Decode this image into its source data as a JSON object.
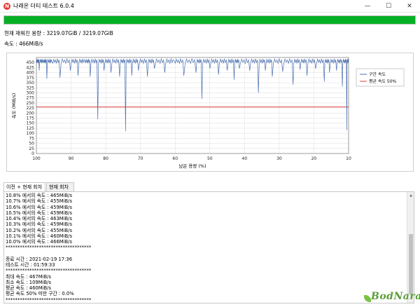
{
  "window": {
    "title": "나래온 더티 테스트 6.0.4",
    "app_icon_glyph": "N",
    "min_glyph": "—",
    "max_glyph": "☐",
    "close_glyph": "✕"
  },
  "progress": {
    "fraction": 1.0,
    "color": "#06b025"
  },
  "info": {
    "remaining": "현재 재워진 용량 : 3219.07GiB / 3219.07GiB",
    "speed": "속도 : 466MiB/s"
  },
  "chart_data": {
    "type": "line",
    "xlabel": "남은 용량 (%)",
    "ylabel": "속도 (MiB/s)",
    "xlim": [
      100,
      10
    ],
    "ylim": [
      0,
      475
    ],
    "x_ticks": [
      100,
      90,
      80,
      70,
      60,
      50,
      40,
      30,
      20,
      10
    ],
    "y_ticks": [
      0,
      25,
      50,
      75,
      100,
      125,
      150,
      175,
      200,
      225,
      250,
      275,
      300,
      325,
      350,
      375,
      400,
      425,
      450
    ],
    "grid": true,
    "legend_position": "right",
    "series": [
      {
        "name": "구간 속도",
        "color": "#4a6fb0",
        "baseline": 458,
        "x": [
          100,
          99.2,
          98,
          97,
          95.5,
          93.2,
          90.2,
          88,
          86,
          84.5,
          82.3,
          80.5,
          78.5,
          76,
          74.3,
          72.5,
          70.6,
          68,
          66,
          63,
          60.3,
          57.5,
          54,
          52.3,
          50,
          47.5,
          45,
          43,
          41.5,
          38.5,
          36,
          34,
          32,
          29,
          26,
          24,
          22,
          19.5,
          17,
          15.5,
          13.5,
          11.8,
          10.5,
          10
        ],
        "y": [
          460,
          410,
          455,
          370,
          450,
          375,
          410,
          385,
          455,
          380,
          170,
          410,
          400,
          380,
          110,
          385,
          410,
          380,
          420,
          400,
          460,
          385,
          400,
          270,
          420,
          390,
          410,
          365,
          420,
          410,
          300,
          410,
          380,
          405,
          340,
          415,
          385,
          420,
          355,
          400,
          410,
          330,
          115,
          460
        ]
      },
      {
        "name": "평균 속도 50%",
        "color": "#e03c3c",
        "y": 230
      }
    ]
  },
  "tabs": [
    {
      "label": "이전 + 현재 회차",
      "active": true
    },
    {
      "label": "현재 회차",
      "active": false
    }
  ],
  "log": {
    "lines": [
      "10.8% 에서의 속도 : 465MiB/s",
      "10.7% 에서의 속도 : 455MiB/s",
      "10.6% 에서의 속도 : 459MiB/s",
      "10.5% 에서의 속도 : 459MiB/s",
      "10.4% 에서의 속도 : 463MiB/s",
      "10.3% 에서의 속도 : 459MiB/s",
      "10.2% 에서의 속도 : 455MiB/s",
      "10.1% 에서의 속도 : 460MiB/s",
      "10.0% 에서의 속도 : 466MiB/s",
      "************************************",
      "",
      "종료 시간 : 2021-02-19 17:36",
      "테스트 시간 : 01:59:33",
      "************************************",
      "최대 속도 : 467MiB/s",
      "최소 속도 : 109MiB/s",
      "평균 속도 : 460MiB/s",
      "평균 속도 50% 미만 구간 : 0.0%",
      "************************************"
    ]
  },
  "watermark": {
    "text": "BodNara"
  }
}
